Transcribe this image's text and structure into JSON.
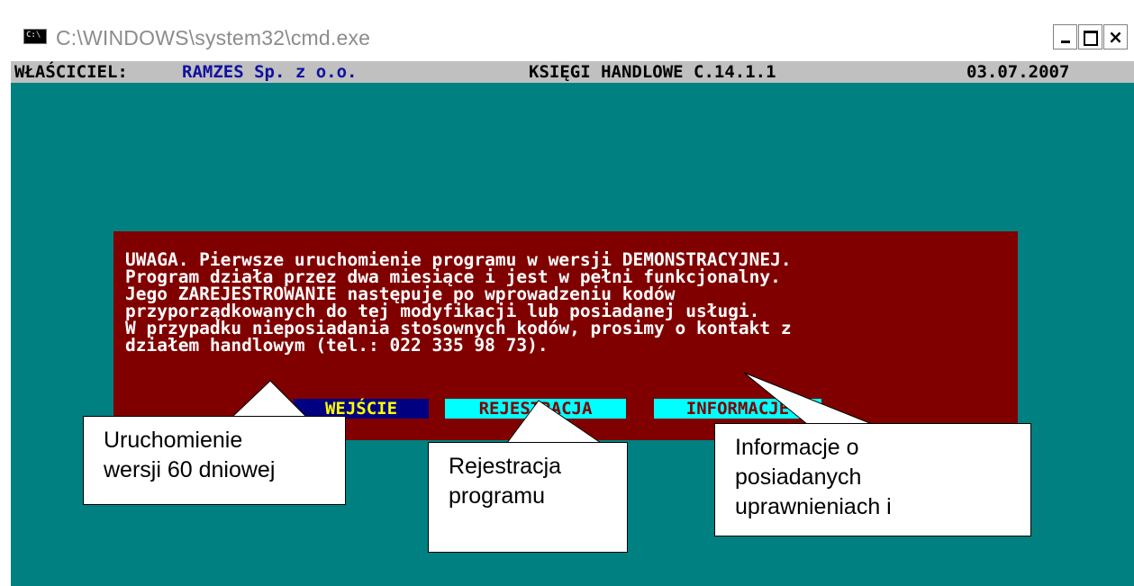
{
  "window": {
    "title": "C:\\WINDOWS\\system32\\cmd.exe",
    "icon": "cmd-icon",
    "controls": {
      "minimize": "minimize",
      "maximize": "maximize",
      "close": "×"
    }
  },
  "statusbar": {
    "owner_label": "WŁAŚCICIEL:",
    "owner_name": "RAMZES Sp. z o.o.",
    "app_name": "KSIĘGI HANDLOWE C.14.1.1",
    "date": "03.07.2007"
  },
  "dialog": {
    "message": "UWAGA. Pierwsze uruchomienie programu w wersji DEMONSTRACYJNEJ.\nProgram działa przez dwa miesiące i jest w pełni funkcjonalny.\nJego ZAREJESTROWANIE następuje po wprowadzeniu kodów\nprzyporządkowanych do tej modyfikacji lub posiadanej usługi.\nW przypadku nieposiadania stosownych kodów, prosimy o kontakt z\ndziałem handlowym (tel.: 022 335 98 73).",
    "buttons": [
      "WEJŚCIE",
      "REJESTRACJA",
      "INFORMACJE"
    ]
  },
  "callouts": [
    {
      "lines": [
        "Uruchomienie",
        "wersji 60 dniowej"
      ]
    },
    {
      "lines": [
        "Rejestracja",
        "programu"
      ]
    },
    {
      "lines": [
        "Informacje o",
        "posiadanych",
        "uprawnieniach i"
      ]
    }
  ],
  "colors": {
    "console_bg": "#008080",
    "dialog_bg": "#800000",
    "statusbar_bg": "#c0c0c0",
    "selected_button_bg": "#000080",
    "selected_button_fg": "#ffff00",
    "button_bg": "#00ffff",
    "button_fg": "#800000"
  }
}
